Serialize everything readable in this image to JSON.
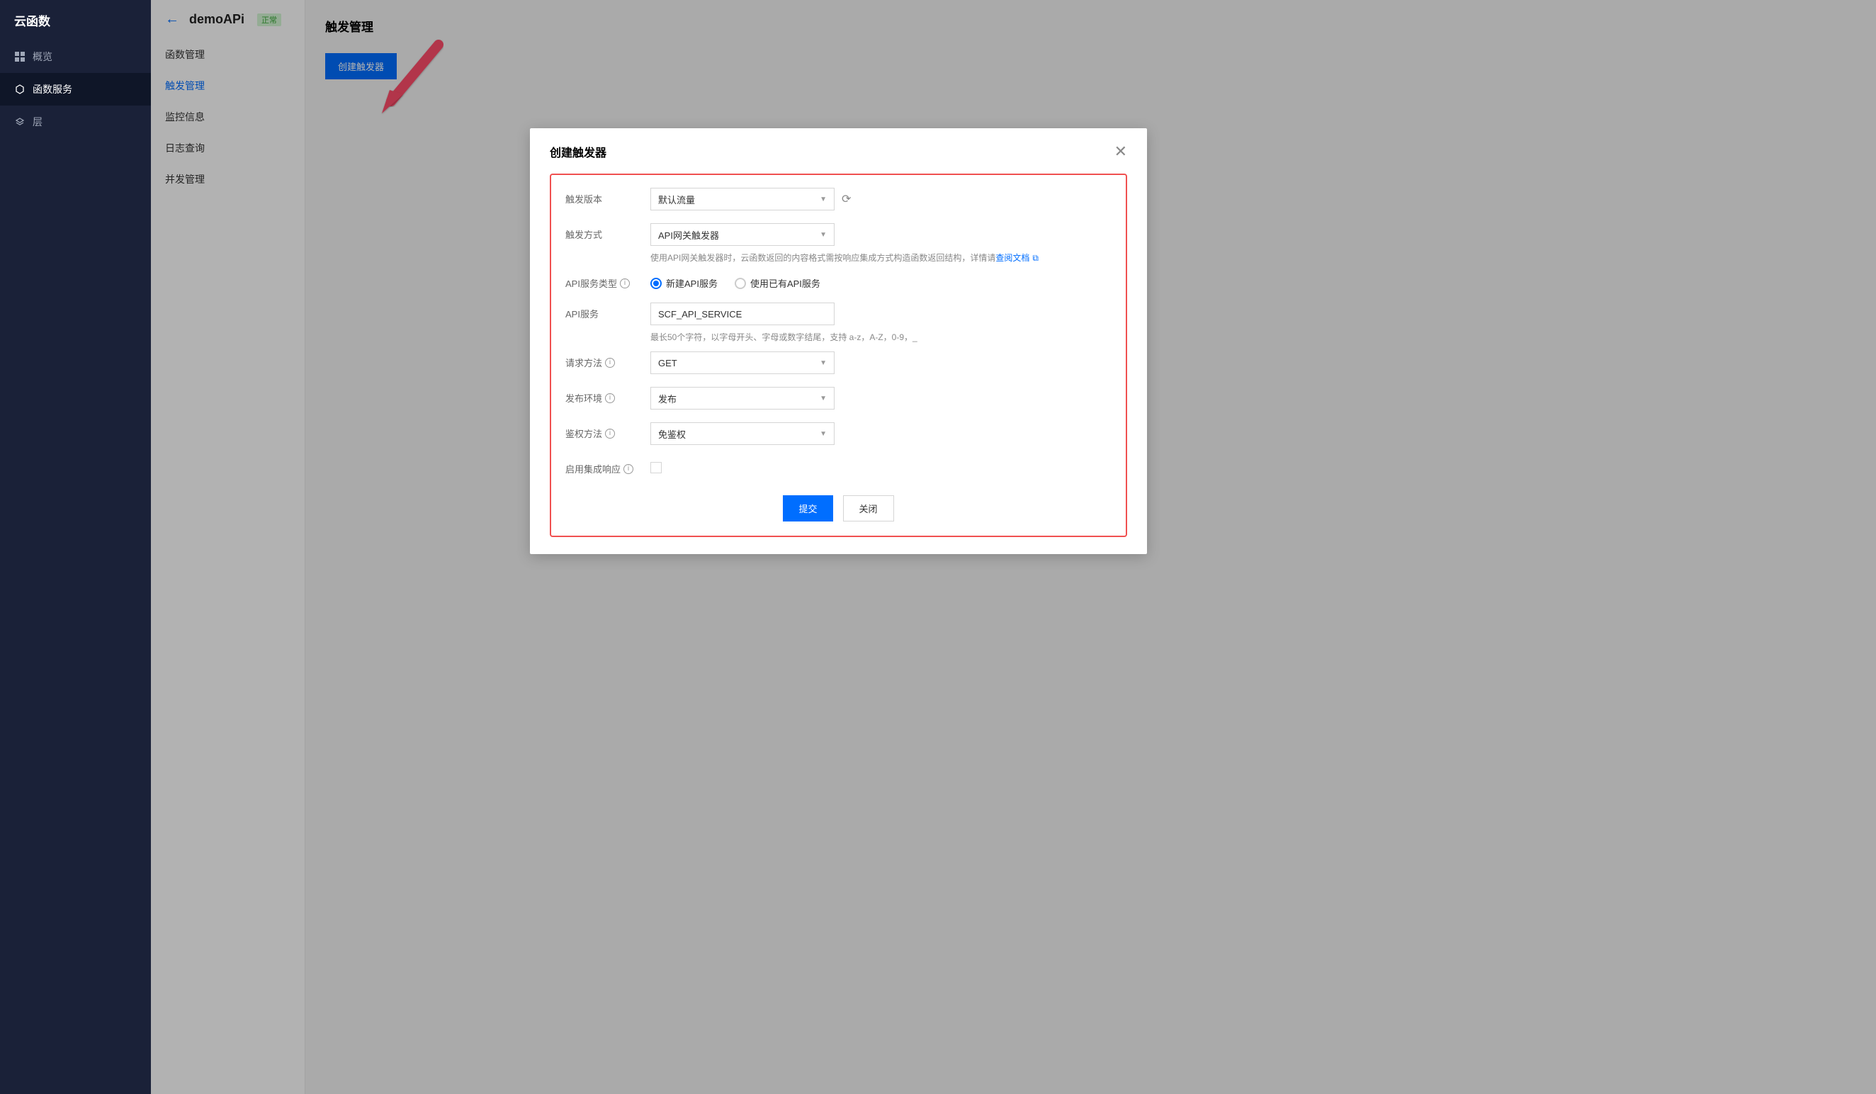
{
  "sidebar": {
    "title": "云函数",
    "items": [
      {
        "label": "概览",
        "icon": "grid"
      },
      {
        "label": "函数服务",
        "icon": "hexagon",
        "active": true
      },
      {
        "label": "层",
        "icon": "layers"
      }
    ]
  },
  "subnav": {
    "title": "demoAPi",
    "status": "正常",
    "items": [
      {
        "label": "函数管理"
      },
      {
        "label": "触发管理",
        "active": true
      },
      {
        "label": "监控信息"
      },
      {
        "label": "日志查询"
      },
      {
        "label": "并发管理"
      }
    ]
  },
  "content": {
    "title": "触发管理",
    "create_button": "创建触发器"
  },
  "modal": {
    "title": "创建触发器",
    "fields": {
      "trigger_version": {
        "label": "触发版本",
        "value": "默认流量"
      },
      "trigger_method": {
        "label": "触发方式",
        "value": "API网关触发器",
        "help_prefix": "使用API网关触发器时，云函数返回的内容格式需按响应集成方式构造函数返回结构，详情请",
        "help_link": "查阅文档"
      },
      "api_service_type": {
        "label": "API服务类型",
        "option1": "新建API服务",
        "option2": "使用已有API服务"
      },
      "api_service": {
        "label": "API服务",
        "value": "SCF_API_SERVICE",
        "help": "最长50个字符，以字母开头、字母或数字结尾，支持 a-z，A-Z，0-9，_"
      },
      "request_method": {
        "label": "请求方法",
        "value": "GET"
      },
      "publish_env": {
        "label": "发布环境",
        "value": "发布"
      },
      "auth_method": {
        "label": "鉴权方法",
        "value": "免鉴权"
      },
      "integrated_response": {
        "label": "启用集成响应"
      }
    },
    "buttons": {
      "submit": "提交",
      "cancel": "关闭"
    }
  }
}
